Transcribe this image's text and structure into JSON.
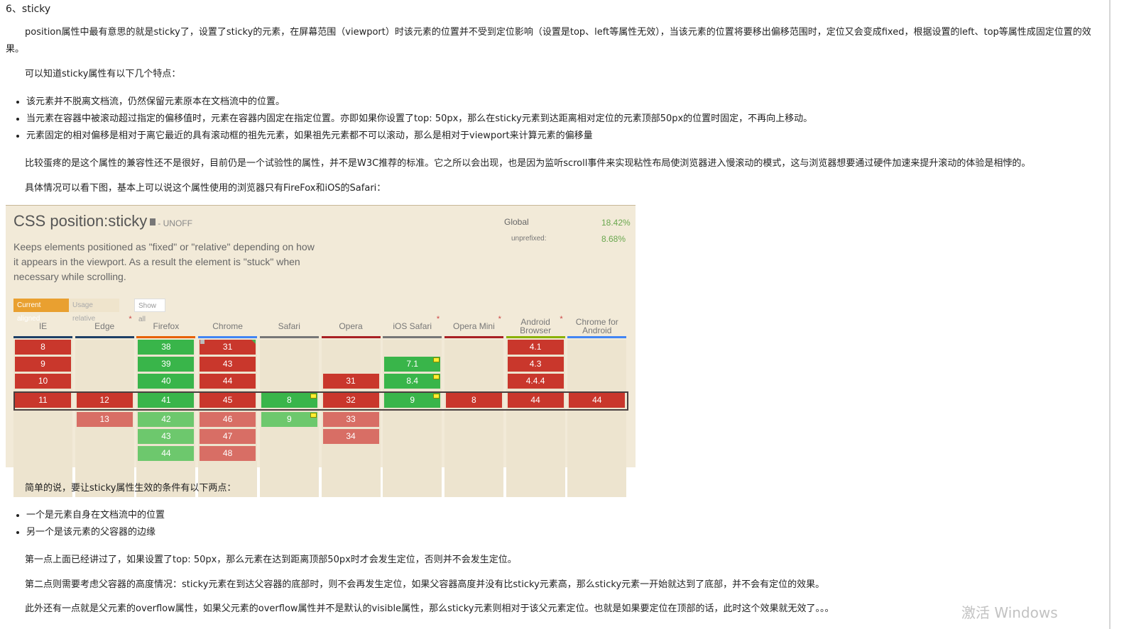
{
  "heading": "6、sticky",
  "paragraphs": {
    "intro": "position属性中最有意思的就是sticky了，设置了sticky的元素，在屏幕范围（viewport）时该元素的位置并不受到定位影响（设置是top、left等属性无效），当该元素的位置将要移出偏移范围时，定位又会变成fixed，根据设置的left、top等属性成固定位置的效果。",
    "features_intro": "可以知道sticky属性有以下几个特点：",
    "features": [
      "该元素并不脱离文档流，仍然保留元素原本在文档流中的位置。",
      "当元素在容器中被滚动超过指定的偏移值时，元素在容器内固定在指定位置。亦即如果你设置了top: 50px，那么在sticky元素到达距离相对定位的元素顶部50px的位置时固定，不再向上移动。",
      "元素固定的相对偏移是相对于离它最近的具有滚动框的祖先元素，如果祖先元素都不可以滚动，那么是相对于viewport来计算元素的偏移量"
    ],
    "compat": "比较蛋疼的是这个属性的兼容性还不是很好，目前仍是一个试验性的属性，并不是W3C推荐的标准。它之所以会出现，也是因为监听scroll事件来实现粘性布局使浏览器进入慢滚动的模式，这与浏览器想要通过硬件加速来提升滚动的体验是相悖的。",
    "browsers": "具体情况可以看下图，基本上可以说这个属性使用的浏览器只有FireFox和iOS的Safari：",
    "conditions_intro": "简单的说，要让sticky属性生效的条件有以下两点：",
    "conditions": [
      "一个是元素自身在文档流中的位置",
      "另一个是该元素的父容器的边缘"
    ],
    "point1": "第一点上面已经讲过了，如果设置了top: 50px，那么元素在达到距离顶部50px时才会发生定位，否则并不会发生定位。",
    "point2": "第二点则需要考虑父容器的高度情况：sticky元素在到达父容器的底部时，则不会再发生定位，如果父容器高度并没有比sticky元素高，那么sticky元素一开始就达到了底部，并不会有定位的效果。",
    "point3": "此外还有一点就是父元素的overflow属性，如果父元素的overflow属性并不是默认的visible属性，那么sticky元素则相对于该父元素定位。也就是如果要定位在顶部的话，此时这个效果就无效了。。。"
  },
  "caniuse": {
    "title": "CSS position:sticky",
    "status": "- UNOFF",
    "description": "Keeps elements positioned as \"fixed\" or \"relative\" depending on how it appears in the viewport. As a result the element is \"stuck\" when necessary while scrolling.",
    "global_label": "Global",
    "global_value": "18.42%",
    "unprefixed_label": "unprefixed:",
    "unprefixed_value": "8.68%",
    "buttons": {
      "current": "Current aligned",
      "usage": "Usage relative",
      "show_all": "Show all"
    },
    "colors": {
      "red": "#c9372c",
      "red_future": "#d86e65",
      "green": "#39b54a",
      "green_future": "#6dc86d",
      "partial": "#a8d13a"
    },
    "browsers": [
      {
        "name": "IE",
        "bar": "#1e3f66",
        "star": false,
        "cells": [
          {
            "v": "8",
            "s": "red",
            "row": 0
          },
          {
            "v": "9",
            "s": "red",
            "row": 1
          },
          {
            "v": "10",
            "s": "red",
            "row": 2
          },
          {
            "v": "11",
            "s": "red",
            "row": 3
          }
        ]
      },
      {
        "name": "Edge",
        "bar": "#1e3f66",
        "star": true,
        "cells": [
          {
            "v": "12",
            "s": "red",
            "row": 3
          },
          {
            "v": "13",
            "s": "red_future",
            "row": 4
          }
        ]
      },
      {
        "name": "Firefox",
        "bar": "#e66000",
        "star": false,
        "cells": [
          {
            "v": "38",
            "s": "green",
            "row": 0
          },
          {
            "v": "39",
            "s": "green",
            "row": 1
          },
          {
            "v": "40",
            "s": "green",
            "row": 2
          },
          {
            "v": "41",
            "s": "green",
            "row": 3
          },
          {
            "v": "42",
            "s": "green_future",
            "row": 4
          },
          {
            "v": "43",
            "s": "green_future",
            "row": 5
          },
          {
            "v": "44",
            "s": "green_future",
            "row": 6
          }
        ]
      },
      {
        "name": "Chrome",
        "bar": "#4285f4",
        "star": false,
        "cells": [
          {
            "v": "31",
            "s": "red",
            "row": 0,
            "flags": true
          },
          {
            "v": "43",
            "s": "red",
            "row": 1
          },
          {
            "v": "44",
            "s": "red",
            "row": 2
          },
          {
            "v": "45",
            "s": "red",
            "row": 3
          },
          {
            "v": "46",
            "s": "red_future",
            "row": 4
          },
          {
            "v": "47",
            "s": "red_future",
            "row": 5
          },
          {
            "v": "48",
            "s": "red_future",
            "row": 6
          }
        ]
      },
      {
        "name": "Safari",
        "bar": "#777777",
        "star": false,
        "cells": [
          {
            "v": "8",
            "s": "green",
            "row": 3,
            "note": true
          },
          {
            "v": "9",
            "s": "green_future",
            "row": 4,
            "note": true
          }
        ]
      },
      {
        "name": "Opera",
        "bar": "#a82024",
        "star": false,
        "cells": [
          {
            "v": "31",
            "s": "red",
            "row": 2
          },
          {
            "v": "32",
            "s": "red",
            "row": 3
          },
          {
            "v": "33",
            "s": "red_future",
            "row": 4
          },
          {
            "v": "34",
            "s": "red_future",
            "row": 5
          }
        ]
      },
      {
        "name": "iOS Safari",
        "bar": "#777777",
        "star": true,
        "cells": [
          {
            "v": "7.1",
            "s": "green",
            "row": 1,
            "note": true
          },
          {
            "v": "8.4",
            "s": "green",
            "row": 2,
            "note": true
          },
          {
            "v": "9",
            "s": "green",
            "row": 3,
            "note": true
          }
        ]
      },
      {
        "name": "Opera Mini",
        "bar": "#a82024",
        "star": true,
        "cells": [
          {
            "v": "8",
            "s": "red",
            "row": 3
          }
        ]
      },
      {
        "name": "Android Browser",
        "bar": "#8ab000",
        "star": true,
        "cells": [
          {
            "v": "4.1",
            "s": "red",
            "row": 0
          },
          {
            "v": "4.3",
            "s": "red",
            "row": 1
          },
          {
            "v": "4.4.4",
            "s": "red",
            "row": 2
          },
          {
            "v": "44",
            "s": "red",
            "row": 3
          }
        ]
      },
      {
        "name": "Chrome for Android",
        "bar": "#4285f4",
        "star": false,
        "cells": [
          {
            "v": "44",
            "s": "red",
            "row": 3
          }
        ]
      }
    ]
  },
  "watermark": "激活 Windows"
}
